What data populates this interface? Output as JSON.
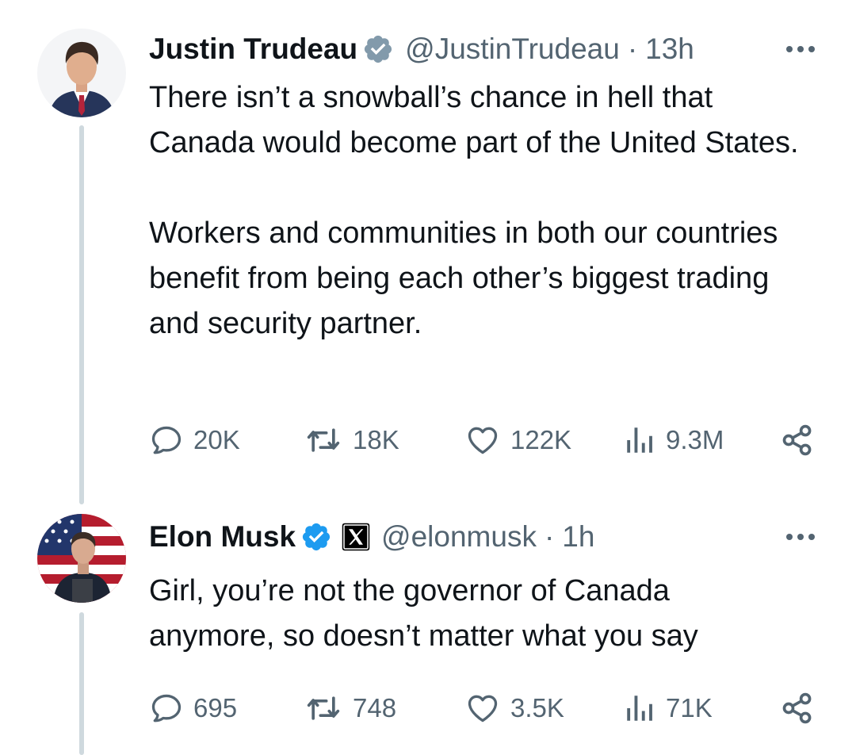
{
  "tweets": [
    {
      "display_name": "Justin Trudeau",
      "handle": "@JustinTrudeau",
      "separator": "·",
      "time": "13h",
      "paragraphs": [
        "There isn’t a snowball’s chance in hell that Canada would become part of the United States.",
        "Workers and communities in both our countries benefit from being each other’s biggest trading and security partner."
      ],
      "stats": {
        "replies": "20K",
        "reposts": "18K",
        "likes": "122K",
        "views": "9.3M"
      },
      "badges": [
        "verified-badge-gray"
      ]
    },
    {
      "display_name": "Elon Musk",
      "handle": "@elonmusk",
      "separator": "·",
      "time": "1h",
      "paragraphs": [
        "Girl, you’re not the governor of Canada anymore, so doesn’t matter what you say"
      ],
      "stats": {
        "replies": "695",
        "reposts": "748",
        "likes": "3.5K",
        "views": "71K"
      },
      "badges": [
        "verified-badge-blue",
        "x-affiliate-badge"
      ]
    }
  ],
  "colors": {
    "text": "#0f1419",
    "secondary": "#536471",
    "thread_line": "#cfd9de",
    "verified_blue": "#1d9bf0",
    "verified_gray": "#829aab"
  }
}
